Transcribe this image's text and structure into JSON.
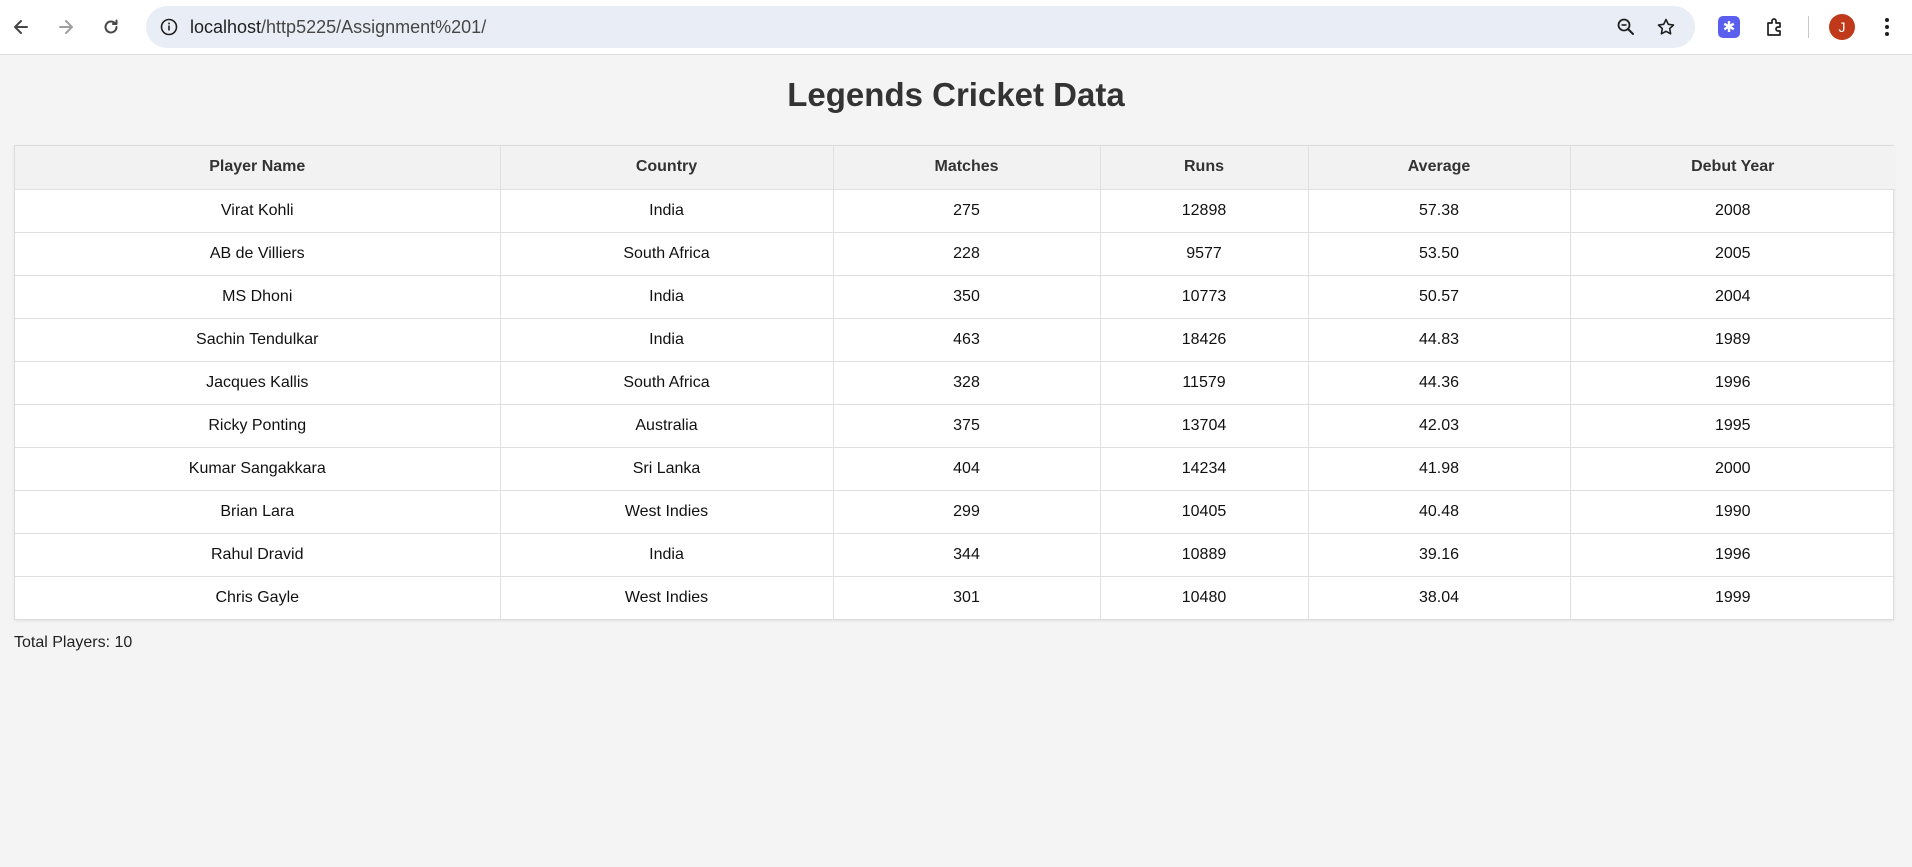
{
  "browser": {
    "url_host": "localhost",
    "url_path": "/http5225/Assignment%201/",
    "avatar_letter": "J"
  },
  "page": {
    "title": "Legends Cricket Data",
    "total_label": "Total Players: 10"
  },
  "table": {
    "headers": [
      "Player Name",
      "Country",
      "Matches",
      "Runs",
      "Average",
      "Debut Year"
    ],
    "rows": [
      [
        "Virat Kohli",
        "India",
        "275",
        "12898",
        "57.38",
        "2008"
      ],
      [
        "AB de Villiers",
        "South Africa",
        "228",
        "9577",
        "53.50",
        "2005"
      ],
      [
        "MS Dhoni",
        "India",
        "350",
        "10773",
        "50.57",
        "2004"
      ],
      [
        "Sachin Tendulkar",
        "India",
        "463",
        "18426",
        "44.83",
        "1989"
      ],
      [
        "Jacques Kallis",
        "South Africa",
        "328",
        "11579",
        "44.36",
        "1996"
      ],
      [
        "Ricky Ponting",
        "Australia",
        "375",
        "13704",
        "42.03",
        "1995"
      ],
      [
        "Kumar Sangakkara",
        "Sri Lanka",
        "404",
        "14234",
        "41.98",
        "2000"
      ],
      [
        "Brian Lara",
        "West Indies",
        "299",
        "10405",
        "40.48",
        "1990"
      ],
      [
        "Rahul Dravid",
        "India",
        "344",
        "10889",
        "39.16",
        "1996"
      ],
      [
        "Chris Gayle",
        "West Indies",
        "301",
        "10480",
        "38.04",
        "1999"
      ]
    ]
  },
  "colors": {
    "page_background": "#f4f4f4",
    "header_background": "#f2f2f2",
    "avatar": "#c0391b",
    "extension": "#5b5fef"
  },
  "icons": [
    "back-icon",
    "forward-icon",
    "reload-icon",
    "site-info-icon",
    "zoom-icon",
    "bookmark-star-icon",
    "extension-icon",
    "puzzle-icon",
    "menu-dots-icon"
  ]
}
